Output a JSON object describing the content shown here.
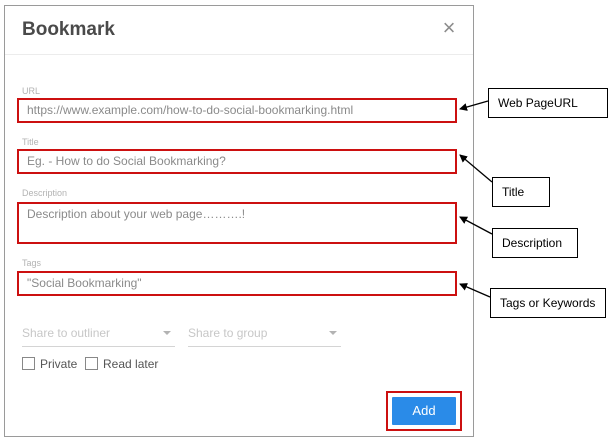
{
  "dialog": {
    "title": "Bookmark",
    "close_glyph": "×"
  },
  "form": {
    "url": {
      "label": "URL",
      "value": "https://www.example.com/how-to-do-social-bookmarking.html"
    },
    "title": {
      "label": "Title",
      "value": "Eg. - How to do Social Bookmarking?"
    },
    "description": {
      "label": "Description",
      "value": "Description about your web page……….!"
    },
    "tags": {
      "label": "Tags",
      "value": "\"Social Bookmarking\""
    },
    "share_outliner": {
      "placeholder": "Share to outliner"
    },
    "share_group": {
      "placeholder": "Share to group"
    },
    "private_label": "Private",
    "read_later_label": "Read later",
    "add_label": "Add"
  },
  "callouts": {
    "url": "Web PageURL",
    "title": "Title",
    "description": "Description",
    "tags": "Tags or Keywords"
  },
  "colors": {
    "highlight": "#cc1010",
    "primary_button": "#2a8be8"
  },
  "icons": [
    "close-icon",
    "chevron-down-icon",
    "checkbox-icon",
    "arrow-icon"
  ]
}
